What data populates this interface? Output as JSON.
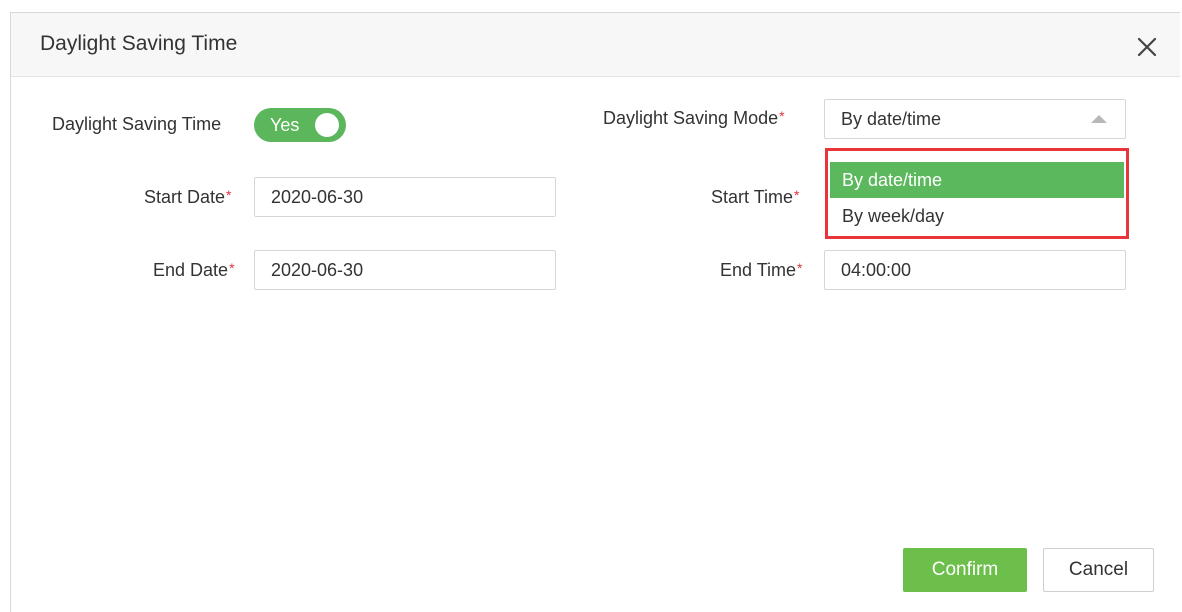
{
  "dialog": {
    "title": "Daylight Saving Time",
    "close_icon": "close-icon"
  },
  "form": {
    "dst_label": "Daylight Saving Time",
    "dst_toggle_value": "Yes",
    "mode_label": "Daylight Saving Mode",
    "mode_value": "By date/time",
    "mode_options": [
      "By date/time",
      "By week/day"
    ],
    "start_date_label": "Start Date",
    "start_date_value": "2020-06-30",
    "start_time_label": "Start Time",
    "end_date_label": "End Date",
    "end_date_value": "2020-06-30",
    "end_time_label": "End Time",
    "end_time_value": "04:00:00",
    "required_mark": "*"
  },
  "buttons": {
    "confirm": "Confirm",
    "cancel": "Cancel"
  },
  "colors": {
    "accent_green": "#5cb85c",
    "highlight_red": "#e8343b",
    "required_red": "#e2323c"
  }
}
